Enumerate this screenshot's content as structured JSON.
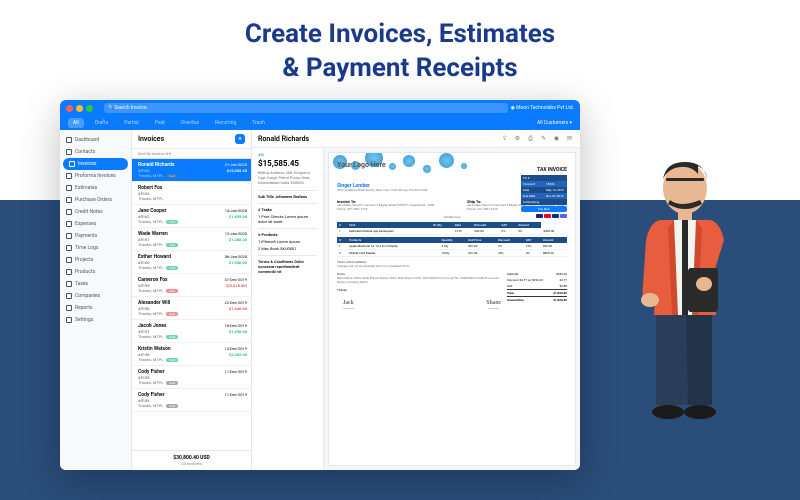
{
  "hero": {
    "line1": "Create Invoices, Estimates",
    "line2": "& Payment Receipts"
  },
  "topbar": {
    "search_placeholder": "Search Invoice",
    "company": "Moon Technolabs Pvt Ltd."
  },
  "tabs": {
    "all": "All",
    "drafts": "Drafts",
    "partial": "Partial",
    "paid": "Paid",
    "overdue": "Overdue",
    "recurring": "Recurring",
    "trash": "Trash",
    "customers": "All Customers ▾"
  },
  "nav": {
    "dashboard": "Dashboard",
    "contacts": "Contacts",
    "invoices": "Invoices",
    "proforma": "Proforma Invoices",
    "estimates": "Estimates",
    "po": "Purchase Orders",
    "credit": "Credit Notes",
    "expenses": "Expenses",
    "payments": "Payments",
    "timelogs": "Time Logs",
    "projects": "Projects",
    "products": "Products",
    "taxes": "Taxes",
    "companies": "Companies",
    "reports": "Reports",
    "settings": "Settings"
  },
  "list": {
    "title": "Invoices",
    "sort": "Sort By Invoice #",
    "total": "$30,800.40 USD",
    "count": "23 Invoices",
    "items": [
      {
        "name": "Ronald Richards",
        "num": "#5164",
        "date": "21-Jan-2020",
        "amt": "$15,585.45",
        "thanks": "Thanks, MTPL",
        "badge": "Sent",
        "bcls": "b-sent",
        "amtcolor": "#fff"
      },
      {
        "name": "Robert Fox",
        "num": "#5163",
        "date": "",
        "amt": "",
        "thanks": "Thanks, MTPL",
        "badge": "",
        "bcls": ""
      },
      {
        "name": "Jane Cooper",
        "num": "#5162",
        "date": "14-Jan-2020",
        "amt": "$1,459.00",
        "thanks": "Thanks, MTPL",
        "badge": "Paid",
        "bcls": "b-paid",
        "amtcolor": "#10b981"
      },
      {
        "name": "Wade Warren",
        "num": "#5161",
        "date": "12-Jan-2020",
        "amt": "$1,288.20",
        "thanks": "Thanks, MTPL",
        "badge": "Paid",
        "bcls": "b-paid",
        "amtcolor": "#10b981"
      },
      {
        "name": "Esther Howard",
        "num": "#5160",
        "date": "06-Jan-2020",
        "amt": "$1,540.00",
        "thanks": "Thanks, MTPL",
        "badge": "Paid",
        "bcls": "b-paid",
        "amtcolor": "#10b981"
      },
      {
        "name": "Cameron Fox",
        "num": "#5159",
        "date": "31-Dec-2019",
        "amt": "$(5,018.00)",
        "thanks": "Thanks, MTPL",
        "badge": "Due",
        "bcls": "b-due",
        "amtcolor": "#ef4444"
      },
      {
        "name": "Alexander Will",
        "num": "#5158",
        "date": "22-Dec-2019",
        "amt": "$1,540.00",
        "thanks": "Thanks, MTPL",
        "badge": "Due",
        "bcls": "b-due",
        "amtcolor": "#ef4444"
      },
      {
        "name": "Jacob Jones",
        "num": "#5157",
        "date": "18-Dec-2019",
        "amt": "$1,390.00",
        "thanks": "Thanks, MTPL",
        "badge": "Paid",
        "bcls": "b-paid",
        "amtcolor": "#10b981"
      },
      {
        "name": "Kristin Watson",
        "num": "#5156",
        "date": "13-Dec-2019",
        "amt": "$2,365.00",
        "thanks": "Thanks, MTPL",
        "badge": "Paid",
        "bcls": "b-paid",
        "amtcolor": "#10b981"
      },
      {
        "name": "Cody Fisher",
        "num": "#5155",
        "date": "11-Dec-2019",
        "amt": "",
        "thanks": "Thanks, MTPL",
        "badge": "Sent",
        "bcls": "b-sent"
      },
      {
        "name": "Cody Fisher",
        "num": "#5154",
        "date": "11-Dec-2019",
        "amt": "",
        "thanks": "Thanks, MTPL",
        "badge": "Sent",
        "bcls": "b-sent"
      }
    ]
  },
  "detail": {
    "name": "Ronald Richards",
    "id_label": "#ID",
    "amount": "$15,585.45",
    "billing": "Billing Address\n406, Kingston\nOpp. Kargil Petrol Pump\nSola, Ahmedabad\nIndia 380060",
    "subtitle": "Sub Title\nJohannes Brahms",
    "tasks_h": "# Tasks",
    "task1": "1 Print Checks\nLorem ipsum dolor sit amet",
    "prod_h": "# Products",
    "prod1": "1 iPhone8\nLorem ipsum",
    "prod2": "2 Mac Book\nSKU0001",
    "terms_side": "Terms & Conditions\nDolor occaecat\nreprehenderit\ncommodo vit"
  },
  "invoice": {
    "logo": "Your Logo Here",
    "type": "TAX INVOICE",
    "meta": {
      "po": "PO #",
      "po_v": "",
      "inv": "Invoice #",
      "inv_v": "18436",
      "date": "Date",
      "date_v": "May 10, 2019",
      "due": "Due Date",
      "due_v": "Nov 22, 2019",
      "out": "Outstanding",
      "out_v": ""
    },
    "paynow": "Pay Now",
    "vendor": "Singer Lumber",
    "vendor_addr": "4257 Southern Street\nRoslyn, New York 11576\nPhone: 516-484-1949",
    "billto_h": "Invoice To:",
    "billto": "Jack Mark\nHarold IT services\n3 Bagley Street\nHOWITT, Queensland - 4880\nPhone: (07) 4091 4725",
    "shipto_h": "Ship To:",
    "shipto": "Jack Mark\nHarold IT services\n3 Bagley Street\nHOWITT, Queensland - 4880\nPhone: (07) 4091 4725",
    "subtitle": "Subtitle here",
    "task_headers": [
      "#",
      "Task",
      "Hr-Qty",
      "Rate",
      "Discount",
      "GST",
      "Amount"
    ],
    "task_rows": [
      [
        "1",
        "Dedicated Mobile App Developers",
        "",
        "10 Hr",
        "$20.00",
        "0%",
        "0%",
        "$200.00"
      ]
    ],
    "prod_headers": [
      "#",
      "Products",
      "Quantity",
      "Unit Price",
      "Discount",
      "GST",
      "Amount"
    ],
    "prod_rows": [
      [
        "1",
        "Apple Macbook Air 13.3 inch Display",
        "3 Qty",
        "$81.00",
        "9%",
        "12%",
        "$42.00"
      ],
      [
        "2",
        "Mobile Card Reader",
        "19Qty",
        "$61.00",
        "34%",
        "0%",
        "$805.20"
      ]
    ],
    "terms_h": "Terms and Conditions",
    "terms": "Charges will not be refunded and not considered at CR",
    "notes_h": "Notes:",
    "notes": "Bank Name: HDFC Bank\nBranch Name: HDFC Main Branch\nIFSC: HDFC0000123\nAccount No: 0000000012345678\nAccount Name: Company Name",
    "totals": {
      "subtotal_l": "Subtotal",
      "subtotal_v": "$954.20",
      "disc_l": "Discount $4.77 on $954.20",
      "disc_v": "$4.77",
      "gst_l": "GST",
      "gst_v": "$5.88",
      "total_l": "Total",
      "total_v": "$1,026.89",
      "due_l": "Amount Due",
      "due_v": "$1,026.89"
    },
    "sig1": "Jack",
    "sig2": "Shane",
    "thanks": "Thanks,"
  }
}
